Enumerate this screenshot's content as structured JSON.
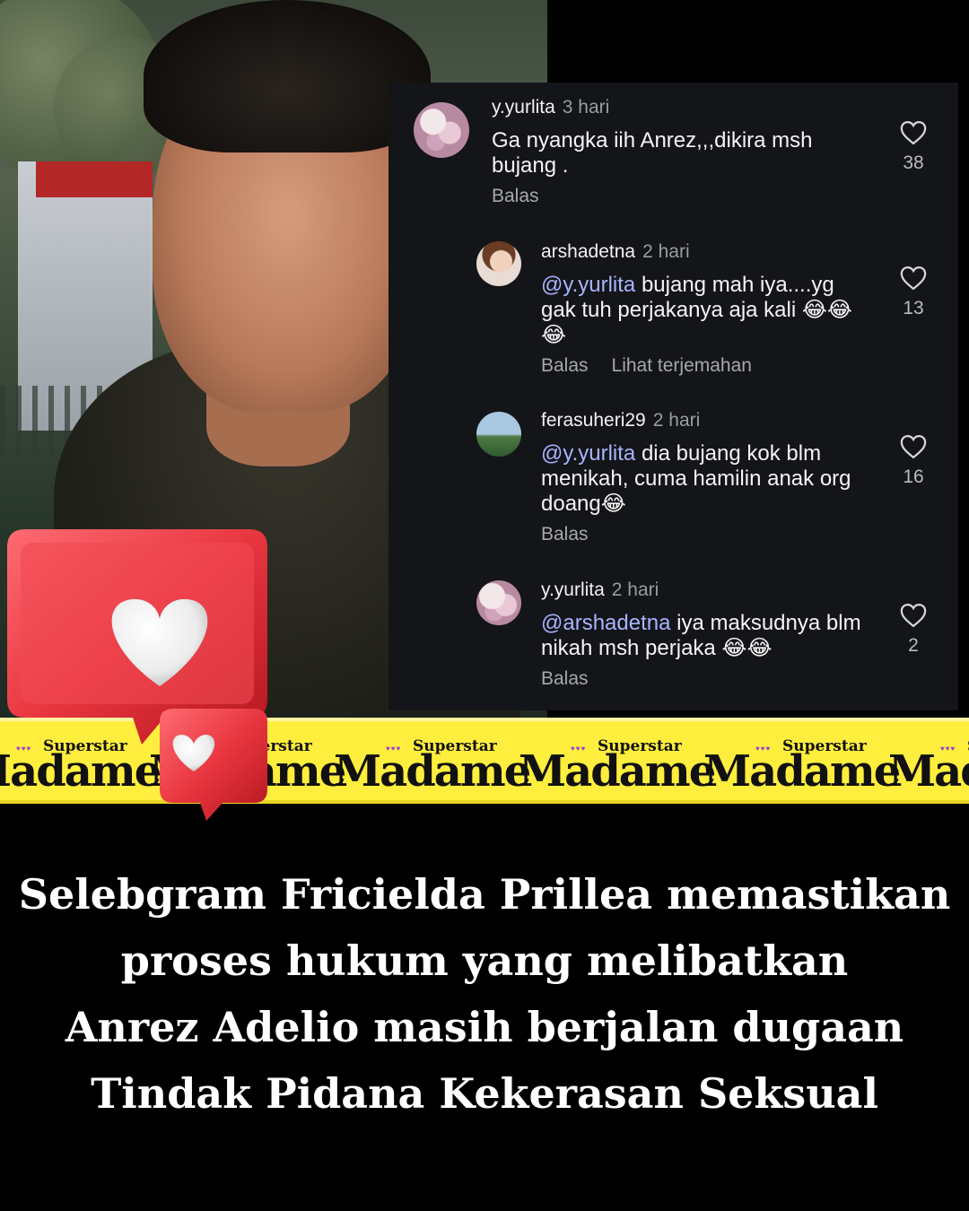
{
  "comments": [
    {
      "username": "y.yurlita",
      "time": "3 hari",
      "mention": "",
      "text": "Ga nyangka iih Anrez,,,dikira msh bujang .",
      "reply_label": "Balas",
      "translate_label": "",
      "likes": "38",
      "avatar_icon": "flowers-avatar"
    },
    {
      "username": "arshadetna",
      "time": "2 hari",
      "mention": "@y.yurlita",
      "text": " bujang mah iya....yg gak tuh perjakanya aja kali 😂😂😂",
      "reply_label": "Balas",
      "translate_label": "Lihat terjemahan",
      "likes": "13",
      "avatar_icon": "woman-avatar"
    },
    {
      "username": "ferasuheri29",
      "time": "2 hari",
      "mention": "@y.yurlita",
      "text": " dia bujang kok blm menikah, cuma hamilin anak org doang😂",
      "reply_label": "Balas",
      "translate_label": "",
      "likes": "16",
      "avatar_icon": "mountain-avatar"
    },
    {
      "username": "y.yurlita",
      "time": "2 hari",
      "mention": "@arshadetna",
      "text": " iya maksudnya blm nikah msh perjaka 😂😂",
      "reply_label": "Balas",
      "translate_label": "",
      "likes": "2",
      "avatar_icon": "flowers-avatar"
    }
  ],
  "banner": {
    "brand_top": "Superstar",
    "brand_main": "Madame",
    "brand_color": "#ffee3d"
  },
  "headline": {
    "line1": "Selebgram Fricielda Prillea memastikan",
    "line2": "proses hukum yang melibatkan",
    "line3": "Anrez Adelio masih berjalan dugaan",
    "line4": "Tindak Pidana Kekerasan Seksual"
  },
  "colors": {
    "panel_bg": "#141519",
    "mention": "#a9b4ff",
    "sticker_red": "#e8353f"
  }
}
